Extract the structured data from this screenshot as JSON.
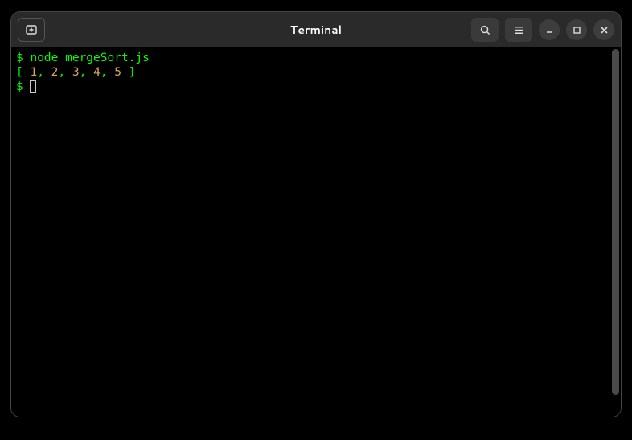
{
  "window": {
    "title": "Terminal"
  },
  "icons": {
    "new_tab": "new-tab-icon",
    "search": "search-icon",
    "menu": "hamburger-icon",
    "minimize": "minimize-icon",
    "maximize": "maximize-icon",
    "close": "close-icon"
  },
  "terminal": {
    "prompt": "$",
    "line1_cmd": "node mergeSort.js",
    "line2_open": "[ ",
    "line2_close": " ]",
    "output_values": [
      "1",
      "2",
      "3",
      "4",
      "5"
    ],
    "sep": ","
  }
}
